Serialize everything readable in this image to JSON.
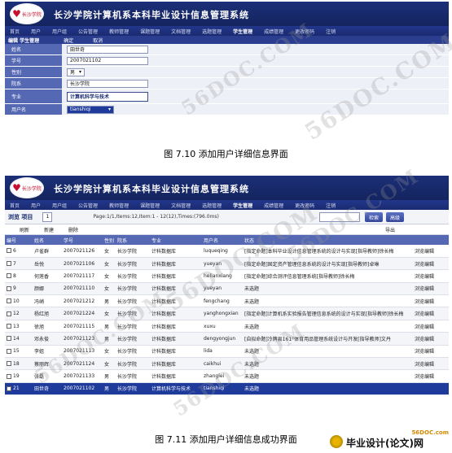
{
  "app": {
    "logo_text": "长沙学院",
    "title": "长沙学院计算机系本科毕业设计信息管理系统"
  },
  "nav": {
    "items": [
      "首页",
      "用户",
      "用户组",
      "公告管理",
      "教师管理",
      "课题管理",
      "文档管理",
      "选题管理",
      "学生管理",
      "成绩管理",
      "更改密码",
      "注销"
    ],
    "active": "学生管理"
  },
  "figure1": {
    "bar_title": "编辑 学生管理",
    "confirm_label": "确定",
    "cancel_label": "取消",
    "fields": [
      {
        "label": "姓名",
        "value": "田世奇"
      },
      {
        "label": "学号",
        "value": "2007021102"
      },
      {
        "label": "性别",
        "value": "男"
      },
      {
        "label": "院系",
        "value": "长沙学院"
      },
      {
        "label": "专业",
        "value": "计算机科学与技术"
      },
      {
        "label": "用户名",
        "value": "tianshiqi"
      }
    ],
    "caption": "图 7.10    添加用户详细信息界面"
  },
  "figure2": {
    "list_title": "浏览 项目",
    "page_box": "1",
    "page_info": "Page:1/1,Items:12,Item:1 - 12(12),Times:(796.0ms)",
    "search_label": "检索",
    "advanced_label": "高级",
    "toolbar": {
      "refresh": "刷新",
      "new": "新建",
      "delete": "删除",
      "export": "导出"
    },
    "columns": [
      "编号",
      "姓名",
      "学号",
      "性别",
      "院系",
      "专业",
      "用户名",
      "状态",
      ""
    ],
    "rows": [
      {
        "id": "6",
        "name": "卢雀群",
        "no": "2007021126",
        "sex": "女",
        "dept": "长沙学院",
        "major": "计科数据库",
        "user": "luqueqing",
        "status": "[指定命题]本科毕业设计信息管理系统的设计与实现[指导教师]徐长梅",
        "ops": "浏览编辑"
      },
      {
        "id": "7",
        "name": "岳悦",
        "no": "2007021106",
        "sex": "女",
        "dept": "长沙学院",
        "major": "计科数据库",
        "user": "yueyan",
        "status": "[指定命题]固定资产管理信息系统的设计与实现[指导教师]卓琳",
        "ops": "浏览编辑"
      },
      {
        "id": "8",
        "name": "何莲香",
        "no": "2007021117",
        "sex": "女",
        "dept": "长沙学院",
        "major": "计科数据库",
        "user": "helianxiang",
        "status": "[指定命题]综合测评信息管理系统[指导教师]徐长梅",
        "ops": "浏览编辑"
      },
      {
        "id": "9",
        "name": "颜娜",
        "no": "2007021110",
        "sex": "女",
        "dept": "长沙学院",
        "major": "计科数据库",
        "user": "yueyan",
        "status": "未选题",
        "ops": "浏览编辑"
      },
      {
        "id": "10",
        "name": "冯峭",
        "no": "2007021212",
        "sex": "男",
        "dept": "长沙学院",
        "major": "计科数据库",
        "user": "fengchang",
        "status": "未选题",
        "ops": "浏览编辑"
      },
      {
        "id": "12",
        "name": "杨红旭",
        "no": "2007021224",
        "sex": "女",
        "dept": "长沙学院",
        "major": "计科数据库",
        "user": "yanghongxian",
        "status": "[指定命题]计算机系实验报告管理信息系统的设计与实现[指导教师]徐长梅",
        "ops": "浏览编辑"
      },
      {
        "id": "13",
        "name": "徐旭",
        "no": "2007021115",
        "sex": "男",
        "dept": "长沙学院",
        "major": "计科数据库",
        "user": "xuxu",
        "status": "未选题",
        "ops": "浏览编辑"
      },
      {
        "id": "14",
        "name": "邓永俊",
        "no": "2007021123",
        "sex": "男",
        "dept": "长沙学院",
        "major": "计科数据库",
        "user": "dengyongjun",
        "status": "[自拟命题]冷牌县161°体育用品管理系统设计与开发[指导教师]文丹",
        "ops": "浏览编辑"
      },
      {
        "id": "15",
        "name": "李姐",
        "no": "2007021113",
        "sex": "女",
        "dept": "长沙学院",
        "major": "计科数据库",
        "user": "lida",
        "status": "未选题",
        "ops": "浏览编辑"
      },
      {
        "id": "18",
        "name": "蔡丽辉",
        "no": "2007021124",
        "sex": "女",
        "dept": "长沙学院",
        "major": "计科数据库",
        "user": "caikhui",
        "status": "未选题",
        "ops": "浏览编辑"
      },
      {
        "id": "19",
        "name": "张磊",
        "no": "2007021133",
        "sex": "男",
        "dept": "长沙学院",
        "major": "计科数据库",
        "user": "zhanglei",
        "status": "未选题",
        "ops": "浏览编辑"
      },
      {
        "id": "21",
        "name": "田世奇",
        "no": "2007021102",
        "sex": "男",
        "dept": "长沙学院",
        "major": "计算机科学与技术",
        "user": "tianshiqi",
        "status": "未选题",
        "ops": "",
        "selected": true
      }
    ],
    "caption": "图 7.11    添加用户详细信息成功界面"
  },
  "watermark": "56DOC.COM",
  "badge": {
    "url": "56DOC.com",
    "name": "毕业设计(论文)网"
  },
  "colors": {
    "header": "#1c2f78",
    "nav": "#22368c",
    "label_bg": "#5568b3",
    "selected": "#1e3a9b",
    "logo_red": "#c8102e"
  }
}
